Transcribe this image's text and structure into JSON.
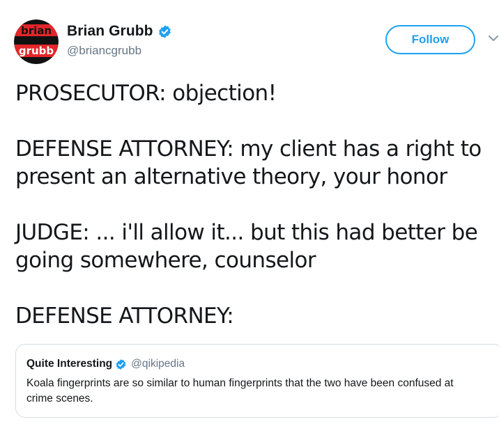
{
  "user": {
    "display_name": "Brian Grubb",
    "handle": "@briancgrubb",
    "avatar_text_top": "brian",
    "avatar_text_bottom": "grubb"
  },
  "follow_label": "Follow",
  "tweet_lines": {
    "line1": "PROSECUTOR: objection!",
    "line2": "DEFENSE ATTORNEY: my client has a right to",
    "line3": "present an alternative theory, your honor",
    "line4": "JUDGE: ... i'll allow it... but this had better be",
    "line5": "going somewhere, counselor",
    "line6": "DEFENSE ATTORNEY:"
  },
  "quoted_tweet": {
    "display_name": "Quite Interesting",
    "handle": "@qikipedia",
    "text": "Koala fingerprints are so similar to human fingerprints that the two have been confused at crime scenes."
  },
  "colors": {
    "accent": "#1da1f2",
    "text": "#14171a",
    "secondary": "#657786",
    "avatar_red": "#e3262a"
  },
  "icons": [
    "verified-badge-icon",
    "chevron-down-icon"
  ]
}
